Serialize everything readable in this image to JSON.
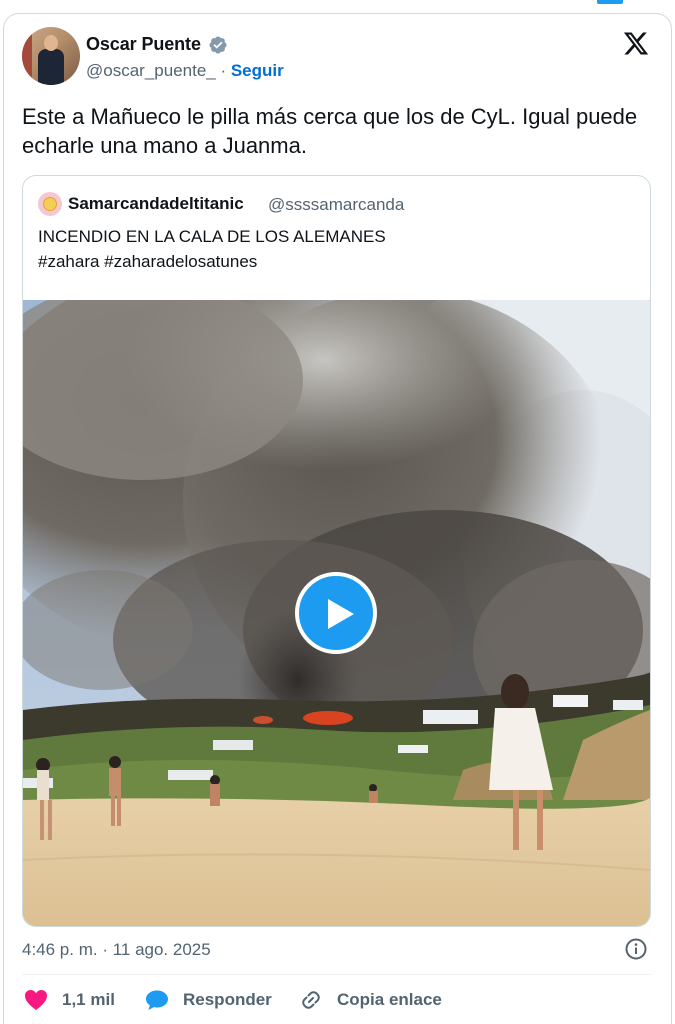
{
  "author": {
    "name": "Oscar Puente",
    "handle": "@oscar_puente_",
    "separator": " · ",
    "follow_label": "Seguir"
  },
  "tweet": {
    "text": "Este a Mañueco le pilla más cerca que los de CyL. Igual puede echarle una mano a Juanma."
  },
  "quoted": {
    "name": "Samarcandadeltitanic",
    "handle": "@ssssamarcanda",
    "line1": "INCENDIO EN LA CALA DE LOS ALEMANES",
    "line2": "#zahara #zaharadelosatunes"
  },
  "meta": {
    "timestamp": "4:46 p. m. · 11 ago. 2025"
  },
  "actions": {
    "like_count": "1,1 mil",
    "reply_label": "Responder",
    "copy_label": "Copia enlace"
  },
  "icons": {
    "brand": "x-logo-icon",
    "verified": "verified-badge-icon",
    "play": "play-icon",
    "info": "info-icon",
    "like": "heart-icon",
    "reply": "reply-bubble-icon",
    "copy": "link-icon"
  },
  "colors": {
    "accent": "#1d9bf0",
    "link": "#006fd6",
    "like": "#f91880",
    "muted": "#536471"
  }
}
